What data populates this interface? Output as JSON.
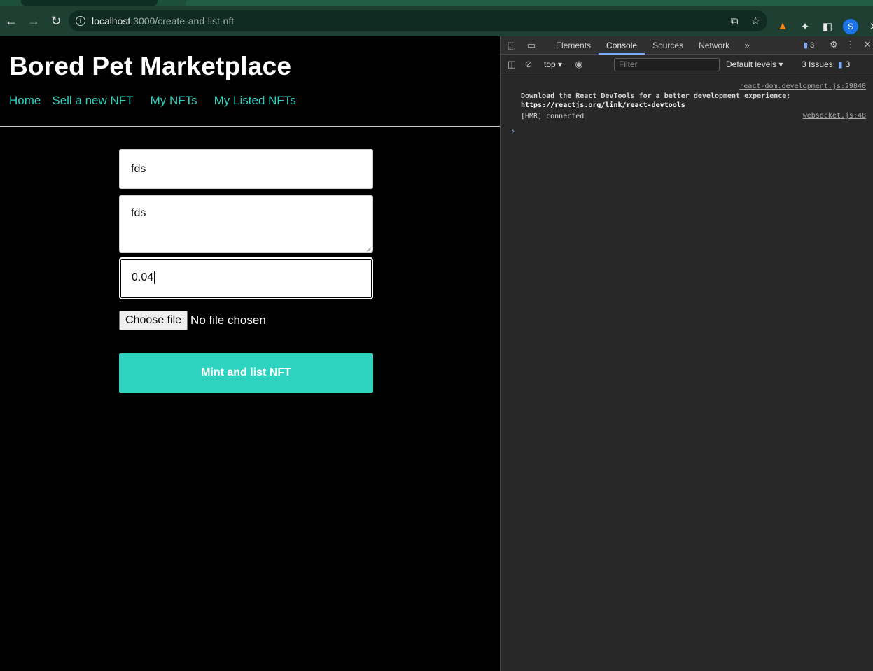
{
  "browser": {
    "url_host": "localhost",
    "url_path": ":3000/create-and-list-nft",
    "avatar_letter": "S"
  },
  "site": {
    "title": "Bored Pet Marketplace",
    "nav": [
      "Home",
      "Sell a new NFT",
      "My NFTs",
      "My Listed NFTs"
    ]
  },
  "form": {
    "name_value": "fds",
    "description_value": "fds",
    "price_value": "0.04",
    "file_button_label": "Choose file",
    "file_status": "No file chosen",
    "submit_label": "Mint and list NFT"
  },
  "devtools": {
    "tabs": [
      "Elements",
      "Console",
      "Sources",
      "Network"
    ],
    "active_tab": "Console",
    "message_count": "3",
    "context": "top",
    "filter_placeholder": "Filter",
    "levels_label": "Default levels",
    "issues_label": "3 Issues:",
    "issues_count": "3",
    "logs": [
      {
        "source": "react-dom.development.js:29840",
        "message": "Download the React DevTools for a better development experience: ",
        "link": "https://reactjs.org/link/react-devtools"
      },
      {
        "source": "websocket.js:48",
        "message": "[HMR] connected"
      }
    ]
  },
  "colors": {
    "accent": "#2ed3c0",
    "toolbar": "#1f3f33"
  }
}
